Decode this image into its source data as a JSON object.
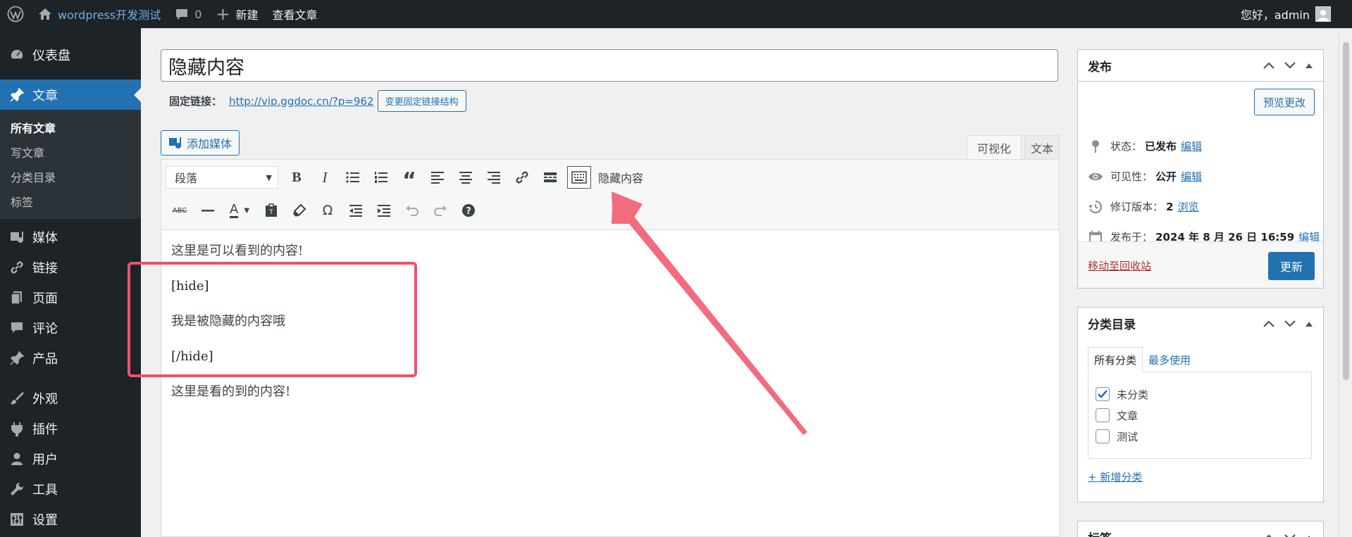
{
  "adminbar": {
    "site_name": "wordpress开发测试",
    "comments_count": "0",
    "new_label": "新建",
    "view_post": "查看文章",
    "greeting": "您好，admin"
  },
  "sidebar": {
    "items": [
      {
        "label": "仪表盘",
        "icon": "dashboard-icon"
      },
      {
        "label": "文章",
        "icon": "pin-icon"
      },
      {
        "label": "媒体",
        "icon": "media-icon"
      },
      {
        "label": "链接",
        "icon": "link-icon"
      },
      {
        "label": "页面",
        "icon": "page-icon"
      },
      {
        "label": "评论",
        "icon": "comment-icon"
      },
      {
        "label": "产品",
        "icon": "pin-icon"
      },
      {
        "label": "外观",
        "icon": "brush-icon"
      },
      {
        "label": "插件",
        "icon": "plugin-icon"
      },
      {
        "label": "用户",
        "icon": "user-icon"
      },
      {
        "label": "工具",
        "icon": "wrench-icon"
      },
      {
        "label": "设置",
        "icon": "settings-icon"
      }
    ],
    "sub": [
      "所有文章",
      "写文章",
      "分类目录",
      "标签"
    ]
  },
  "editor": {
    "post_title": "隐藏内容",
    "permalink_label": "固定链接：",
    "permalink_url": "http://vip.ggdoc.cn/?p=962",
    "permalink_btn": "变更固定链接结构",
    "add_media": "添加媒体",
    "tab_visual": "可视化",
    "tab_text": "文本",
    "format": "段落",
    "hide_button_label": "隐藏内容",
    "paragraphs": [
      "这里是可以看到的内容!",
      "[hide]",
      "我是被隐藏的内容哦",
      "[/hide]",
      "这里是看的到的内容!"
    ]
  },
  "publish": {
    "title": "发布",
    "preview": "预览更改",
    "status_label": "状态：",
    "status_value": "已发布",
    "visibility_label": "可见性：",
    "visibility_value": "公开",
    "revisions_label": "修订版本：",
    "revisions_value": "2",
    "browse": "浏览",
    "published_label": "发布于：",
    "published_value": "2024 年 8 月 26 日 16:59",
    "edit": "编辑",
    "trash": "移动至回收站",
    "update": "更新"
  },
  "categories": {
    "title": "分类目录",
    "tab_all": "所有分类",
    "tab_popular": "最多使用",
    "items": [
      {
        "label": "未分类",
        "checked": true
      },
      {
        "label": "文章",
        "checked": false
      },
      {
        "label": "测试",
        "checked": false
      }
    ],
    "add_new": "+ 新增分类"
  },
  "tags": {
    "title": "标签"
  },
  "colors": {
    "accent": "#2271b1",
    "annotation": "#f0506e",
    "admin_dark": "#1d2327"
  }
}
